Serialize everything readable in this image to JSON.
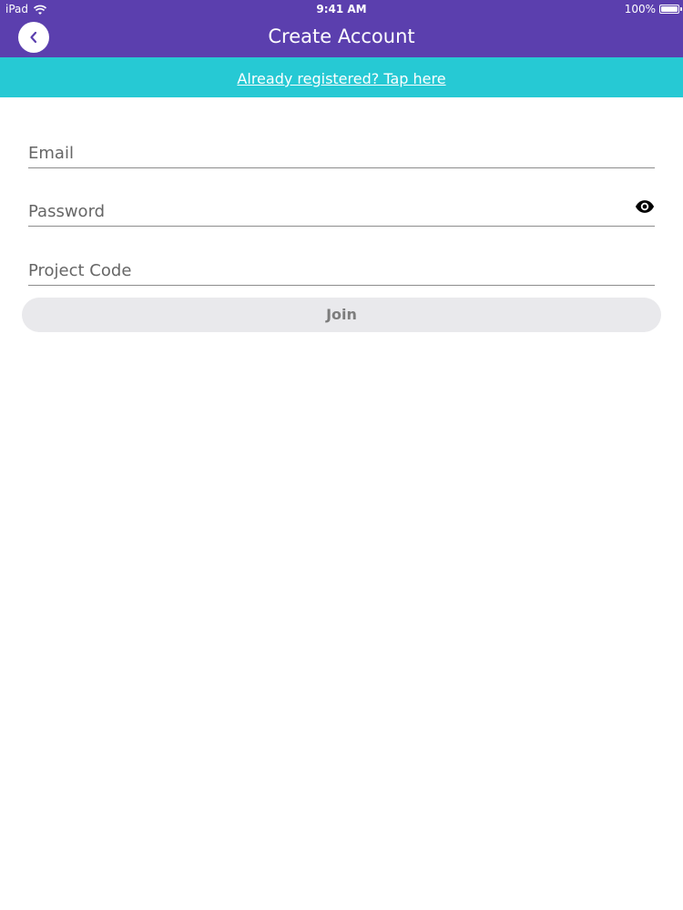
{
  "status_bar": {
    "device": "iPad",
    "time": "9:41 AM",
    "battery": "100%"
  },
  "nav": {
    "title": "Create Account",
    "back_icon": "chevron-left-icon"
  },
  "banner": {
    "link_text": "Already registered? Tap here"
  },
  "form": {
    "email": {
      "placeholder": "Email",
      "value": ""
    },
    "password": {
      "placeholder": "Password",
      "value": "",
      "toggle_icon": "eye-icon"
    },
    "project_code": {
      "placeholder": "Project Code",
      "value": ""
    },
    "join_label": "Join"
  },
  "colors": {
    "header": "#5b3fae",
    "banner": "#26c9d4",
    "button_bg": "#e9e9ec",
    "button_text": "#7d7d7d"
  }
}
